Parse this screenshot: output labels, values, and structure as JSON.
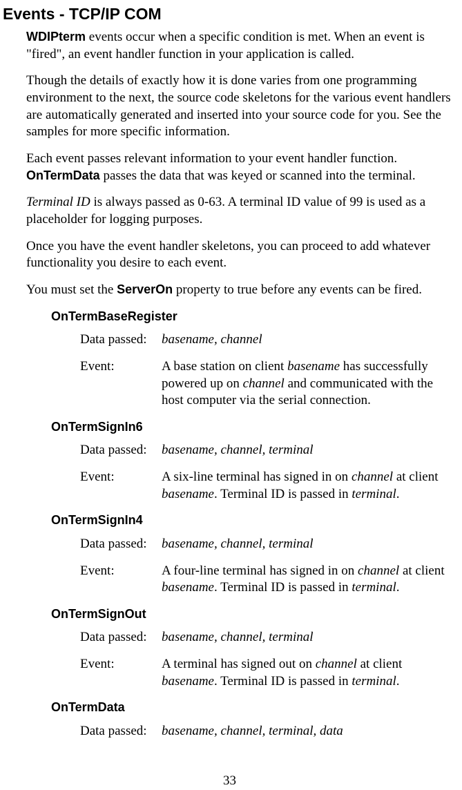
{
  "heading": "Events - TCP/IP COM",
  "intro": {
    "p1_lead_bold": "WDIPterm",
    "p1_rest": " events occur when a specific condition is met.  When an event is \"fired\", an event handler function in your application is called.",
    "p2": "Though the details of exactly how it is done varies from one programming environment to the next, the source code skeletons for the various event handlers are automatically generated and inserted into your source code for you. See the samples for more specific information.",
    "p3a": "Each event passes relevant information to your event handler function. ",
    "p3_bold": "OnTermData",
    "p3b": " passes the data that was keyed or scanned into the terminal.",
    "p4_italic": "Terminal ID",
    "p4_rest": " is always passed as 0-63.  A terminal ID value of 99 is used as a placeholder for logging purposes.",
    "p5": "Once you have the event handler skeletons, you can proceed to add whatever functionality you desire to each event.",
    "p6a": "You must set the ",
    "p6_bold": "ServerOn",
    "p6b": " property to true before any events can be fired."
  },
  "labels": {
    "data_passed": "Data passed:",
    "event": "Event:"
  },
  "events": {
    "e1": {
      "name": "OnTermBaseRegister",
      "data": "basename, channel",
      "desc_a": "A base station on client ",
      "desc_i1": "basename",
      "desc_b": " has successfully powered up on ",
      "desc_i2": "channel",
      "desc_c": " and communicated with the host computer via the serial connection."
    },
    "e2": {
      "name": "OnTermSignIn6",
      "data": "basename, channel, terminal",
      "desc_a": "A six-line terminal has signed in on ",
      "desc_i1": "channel",
      "desc_b": " at client ",
      "desc_i2": "basename",
      "desc_c": ". Terminal ID is passed in ",
      "desc_i3": "terminal",
      "desc_d": "."
    },
    "e3": {
      "name": "OnTermSignIn4",
      "data": "basename, channel, terminal",
      "desc_a": "A four-line terminal has signed in on ",
      "desc_i1": "channel",
      "desc_b": " at client ",
      "desc_i2": "basename",
      "desc_c": ". Terminal ID is passed in ",
      "desc_i3": "terminal",
      "desc_d": "."
    },
    "e4": {
      "name": "OnTermSignOut",
      "data": "basename, channel, terminal",
      "desc_a": "A terminal has signed out on ",
      "desc_i1": "channel",
      "desc_b": " at client ",
      "desc_i2": "basename",
      "desc_c": ". Terminal ID is passed in ",
      "desc_i3": "terminal",
      "desc_d": "."
    },
    "e5": {
      "name": "OnTermData",
      "data": "basename, channel, terminal, data"
    }
  },
  "page_number": "33"
}
